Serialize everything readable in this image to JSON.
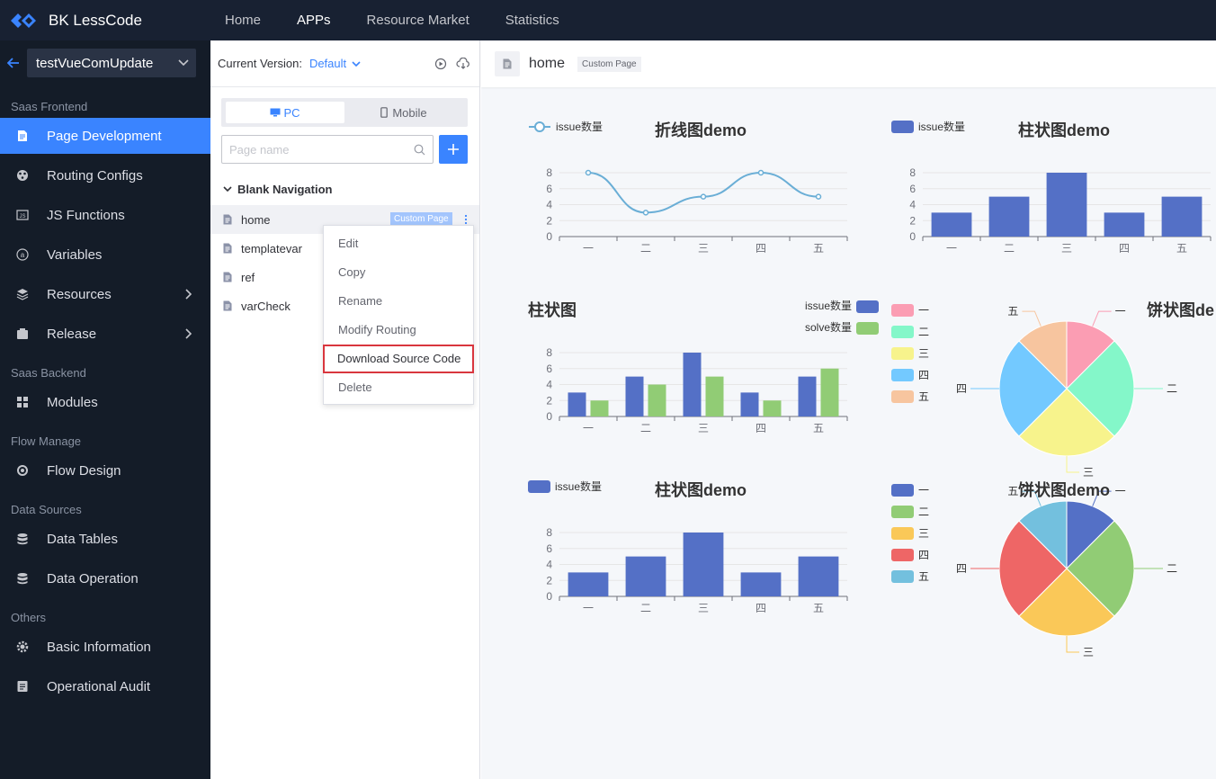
{
  "topbar": {
    "brand": "BK LessCode",
    "nav": [
      "Home",
      "APPs",
      "Resource Market",
      "Statistics"
    ],
    "active_index": 1
  },
  "sidebar": {
    "app_name": "testVueComUpdate",
    "groups": [
      {
        "title": "Saas Frontend",
        "items": [
          {
            "label": "Page Development",
            "icon": "page-icon",
            "active": true
          },
          {
            "label": "Routing Configs",
            "icon": "routing-icon"
          },
          {
            "label": "JS Functions",
            "icon": "js-icon"
          },
          {
            "label": "Variables",
            "icon": "variable-icon"
          },
          {
            "label": "Resources",
            "icon": "layers-icon",
            "arrow": true
          },
          {
            "label": "Release",
            "icon": "release-icon",
            "arrow": true
          }
        ]
      },
      {
        "title": "Saas Backend",
        "items": [
          {
            "label": "Modules",
            "icon": "modules-icon"
          }
        ]
      },
      {
        "title": "Flow Manage",
        "items": [
          {
            "label": "Flow Design",
            "icon": "flow-icon"
          }
        ]
      },
      {
        "title": "Data Sources",
        "items": [
          {
            "label": "Data Tables",
            "icon": "database-icon"
          },
          {
            "label": "Data Operation",
            "icon": "database-icon"
          }
        ]
      },
      {
        "title": "Others",
        "items": [
          {
            "label": "Basic Information",
            "icon": "gear-icon"
          },
          {
            "label": "Operational Audit",
            "icon": "audit-icon"
          }
        ]
      }
    ]
  },
  "panel": {
    "version_label": "Current Version:",
    "version_value": "Default",
    "tabs": {
      "pc": "PC",
      "mobile": "Mobile"
    },
    "search_placeholder": "Page name",
    "tree_title": "Blank Navigation",
    "pages": [
      {
        "name": "home",
        "badge": "Custom Page",
        "active": true
      },
      {
        "name": "templatevar"
      },
      {
        "name": "ref"
      },
      {
        "name": "varCheck"
      }
    ],
    "context_menu": [
      "Edit",
      "Copy",
      "Rename",
      "Modify Routing",
      "Download Source Code",
      "Delete"
    ],
    "highlighted_menu_item": "Download Source Code"
  },
  "content": {
    "page_title": "home",
    "page_tag": "Custom Page"
  },
  "colors": {
    "accent": "#3a84ff",
    "topbar": "#182132",
    "sidebar": "#141c28",
    "highlight_border": "#d9363e"
  },
  "chart_data": [
    {
      "type": "line",
      "title": "折线图demo",
      "legend": [
        "issue数量"
      ],
      "categories": [
        "一",
        "二",
        "三",
        "四",
        "五"
      ],
      "series": [
        {
          "name": "issue数量",
          "values": [
            8,
            3,
            5,
            8,
            5
          ],
          "color": "#6aaed6"
        }
      ],
      "ylim": [
        0,
        8
      ],
      "yticks": [
        0,
        2,
        4,
        6,
        8
      ]
    },
    {
      "type": "bar",
      "title": "柱状图demo",
      "legend": [
        "issue数量"
      ],
      "categories": [
        "一",
        "二",
        "三",
        "四",
        "五"
      ],
      "series": [
        {
          "name": "issue数量",
          "values": [
            3,
            5,
            8,
            3,
            5
          ],
          "color": "#5470c6"
        }
      ],
      "ylim": [
        0,
        8
      ],
      "yticks": [
        0,
        2,
        4,
        6,
        8
      ]
    },
    {
      "type": "bar",
      "title": "柱状图",
      "legend": [
        "issue数量",
        "solve数量"
      ],
      "legend_position": "top-right",
      "categories": [
        "一",
        "二",
        "三",
        "四",
        "五"
      ],
      "series": [
        {
          "name": "issue数量",
          "values": [
            3,
            5,
            8,
            3,
            5
          ],
          "color": "#5470c6"
        },
        {
          "name": "solve数量",
          "values": [
            2,
            4,
            5,
            2,
            6
          ],
          "color": "#91cc75"
        }
      ],
      "ylim": [
        0,
        8
      ],
      "yticks": [
        0,
        2,
        4,
        6,
        8
      ]
    },
    {
      "type": "pie",
      "title": "饼状图de",
      "legend": [
        "一",
        "二",
        "三",
        "四",
        "五"
      ],
      "labels": [
        "一",
        "二",
        "三",
        "四",
        "五"
      ],
      "values": [
        1,
        2,
        2,
        2,
        1
      ],
      "colors": [
        "#fb9db3",
        "#84f7c9",
        "#f7f38c",
        "#73c9ff",
        "#f7c59f"
      ]
    },
    {
      "type": "bar",
      "title": "柱状图demo",
      "legend": [
        "issue数量"
      ],
      "categories": [
        "一",
        "二",
        "三",
        "四",
        "五"
      ],
      "series": [
        {
          "name": "issue数量",
          "values": [
            3,
            5,
            8,
            3,
            5
          ],
          "color": "#5470c6"
        }
      ],
      "ylim": [
        0,
        8
      ],
      "yticks": [
        0,
        2,
        4,
        6,
        8
      ]
    },
    {
      "type": "pie",
      "title": "饼状图demo",
      "legend": [
        "一",
        "二",
        "三",
        "四",
        "五"
      ],
      "labels": [
        "一",
        "二",
        "三",
        "四",
        "五"
      ],
      "values": [
        1,
        2,
        2,
        2,
        1
      ],
      "colors": [
        "#5470c6",
        "#91cc75",
        "#fac858",
        "#ee6666",
        "#73c0de"
      ]
    }
  ]
}
